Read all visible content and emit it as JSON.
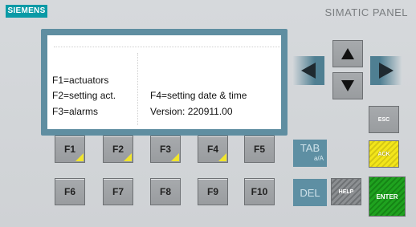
{
  "header": {
    "brand": "SIEMENS",
    "model": "SIMATIC PANEL"
  },
  "screen": {
    "line1": "F1=actuators",
    "line2_left": "F2=setting act.",
    "line2_right": "F4=setting date & time",
    "line3_left": "F3=alarms",
    "line3_right": "Version: 220911.00"
  },
  "function_keys": [
    "F1",
    "F2",
    "F3",
    "F4",
    "F5",
    "F6",
    "F7",
    "F8",
    "F9",
    "F10"
  ],
  "keys": {
    "tab": "TAB",
    "tab_sub": "a/A",
    "del": "DEL",
    "esc": "ESC",
    "ack": "ACK",
    "help": "HELP",
    "enter": "ENTER"
  },
  "colors": {
    "brand": "#0a9aa6",
    "display_frame": "#5f8ea1",
    "led_corner": "#f1e52c",
    "ack_key": "#f3e61a",
    "enter_key": "#1a9a1a"
  },
  "icons": [
    "arrow-up-icon",
    "arrow-down-icon",
    "arrow-left-icon",
    "arrow-right-icon"
  ]
}
